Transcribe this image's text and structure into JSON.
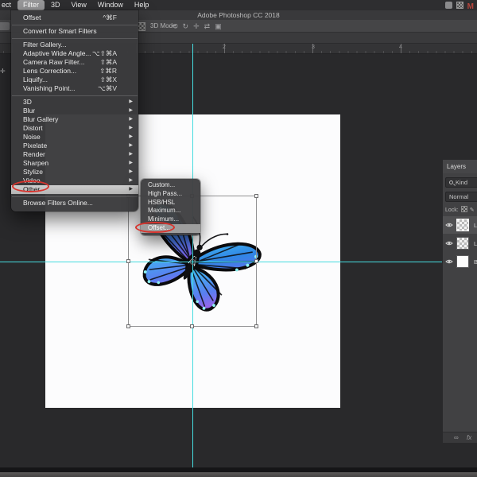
{
  "menubar": {
    "item_partial": "ect",
    "item_filter": "Filter",
    "item_3d": "3D",
    "item_view": "View",
    "item_window": "Window",
    "item_help": "Help"
  },
  "titlebar": {
    "title": "Adobe Photoshop CC 2018"
  },
  "options_bar": {
    "mode_label": "3D Mode:"
  },
  "ruler": {
    "tick_2": "2",
    "tick_3": "3",
    "tick_4": "4"
  },
  "filter_menu": {
    "offset_recent": {
      "label": "Offset",
      "shortcut": "^⌘F"
    },
    "convert": {
      "label": "Convert for Smart Filters"
    },
    "gallery": {
      "label": "Filter Gallery..."
    },
    "adaptive": {
      "label": "Adaptive Wide Angle...",
      "shortcut": "⌥⇧⌘A"
    },
    "camera_raw": {
      "label": "Camera Raw Filter...",
      "shortcut": "⇧⌘A"
    },
    "lens": {
      "label": "Lens Correction...",
      "shortcut": "⇧⌘R"
    },
    "liquify": {
      "label": "Liquify...",
      "shortcut": "⇧⌘X"
    },
    "vanishing": {
      "label": "Vanishing Point...",
      "shortcut": "⌥⌘V"
    },
    "sub_3d": "3D",
    "sub_blur": "Blur",
    "sub_blur_gallery": "Blur Gallery",
    "sub_distort": "Distort",
    "sub_noise": "Noise",
    "sub_pixelate": "Pixelate",
    "sub_render": "Render",
    "sub_sharpen": "Sharpen",
    "sub_stylize": "Stylize",
    "sub_video": "Video",
    "sub_other": "Other",
    "browse": "Browse Filters Online..."
  },
  "other_submenu": {
    "custom": "Custom...",
    "high_pass": "High Pass...",
    "hsb_hsl": "HSB/HSL",
    "maximum": "Maximum...",
    "minimum": "Minimum...",
    "offset": "Offset..."
  },
  "layers_panel": {
    "tab": "Layers",
    "kind_filter": "Kind",
    "blend_mode": "Normal",
    "lock_label": "Lock:",
    "layers": [
      {
        "name_partial": "L"
      },
      {
        "name_partial": "L"
      },
      {
        "name_partial": "B"
      }
    ]
  },
  "icons": {
    "m_logo": "M",
    "submenu_arrow": "▶",
    "orbit": "⟲",
    "roll": "↻",
    "pan": "✛",
    "slide": "⇄",
    "camera": "▣",
    "move_tool_sliver": "✛",
    "link": "∞",
    "fx": "fx",
    "brush": "✎"
  },
  "annotation_color": "#d8342e",
  "guide_color": "#45dcdf"
}
